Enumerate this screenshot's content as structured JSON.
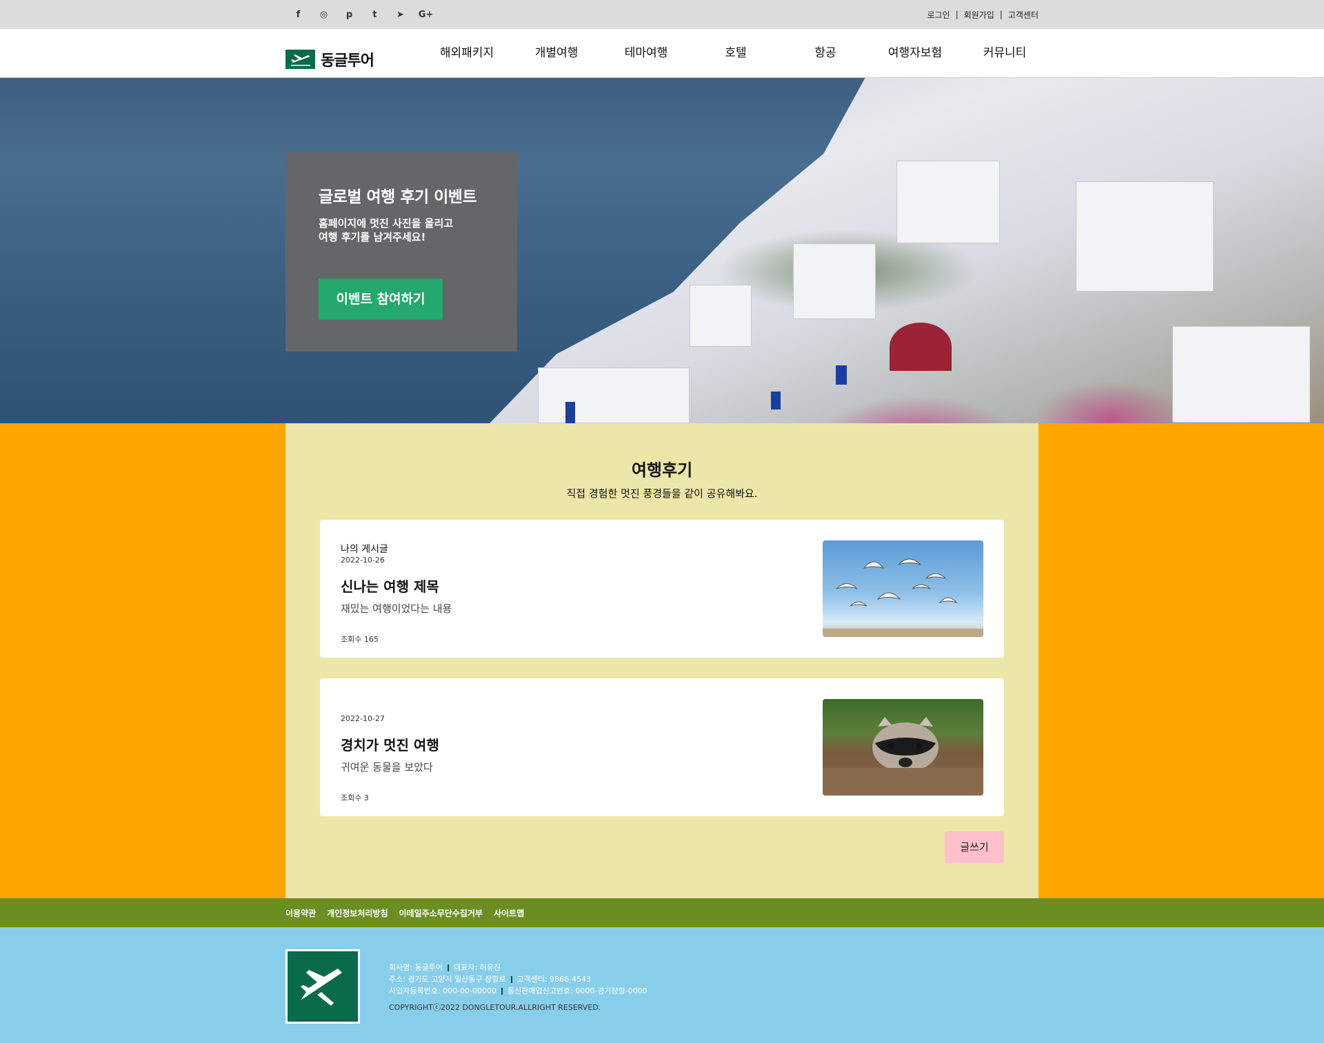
{
  "topbar": {
    "social": [
      {
        "name": "facebook-icon",
        "glyph": "f"
      },
      {
        "name": "instagram-icon",
        "glyph": "◎"
      },
      {
        "name": "pinterest-icon",
        "glyph": "p"
      },
      {
        "name": "twitter-icon",
        "glyph": "t"
      },
      {
        "name": "telegram-icon",
        "glyph": "➤"
      },
      {
        "name": "google-plus-icon",
        "glyph": "G+"
      }
    ],
    "login": "로그인",
    "join": "회원가입",
    "support": "고객센터",
    "sep": "|"
  },
  "header": {
    "logo_text": "동글투어",
    "menu": [
      "해외패키지",
      "개별여행",
      "테마여행",
      "호텔",
      "항공",
      "여행자보험",
      "커뮤니티"
    ]
  },
  "hero": {
    "title": "글로벌 여행 후기 이벤트",
    "subtitle": "홈페이지에 멋진 사진을 올리고\n여행 후기를 남겨주세요!",
    "button": "이벤트 참여하기"
  },
  "reviews": {
    "title": "여행후기",
    "subtitle": "직접 경험한 멋진 풍경들을 같이 공유해봐요.",
    "posts": [
      {
        "writer": "나의 게시글",
        "date": "2022-10-26",
        "title": "신나는 여행 제목",
        "desc": "재밌는 여행이었다는 내용",
        "views": "조회수 165",
        "image": "seagulls-photo"
      },
      {
        "writer": "",
        "date": "2022-10-27",
        "title": "경치가 멋진 여행",
        "desc": "귀여운 동물을 보았다",
        "views": "조회수 3",
        "image": "raccoon-photo"
      }
    ],
    "write_button": "글쓰기"
  },
  "footer": {
    "links": [
      "이용약관",
      "개인정보처리방침",
      "이메일주소무단수집거부",
      "사이트맵"
    ],
    "company": "회사명: 동글투어",
    "ceo": "대표자: 허유진",
    "address": "주소: 경기도 고양시 일산동구 장항로",
    "phone": "고객센터: 9866-4543",
    "biz_no": "사업자등록번호: 000-00-00000",
    "sales_no": "통신판매업신고번호: 0000-경기장항-0000",
    "copyright": "COPYRIGHTⓒ2022 DONGLETOUR.ALLRIGHT RESERVED."
  },
  "colors": {
    "topbar": "#dcdcdc",
    "brand_green": "#0a6b4b",
    "button_green": "#23a96b",
    "content_bg": "#ffa500",
    "panel_bg": "#ece6a8",
    "write_button": "#ffc0cb",
    "footer_links_bg": "#6b8e23",
    "footer_bg": "#87ceeb"
  }
}
